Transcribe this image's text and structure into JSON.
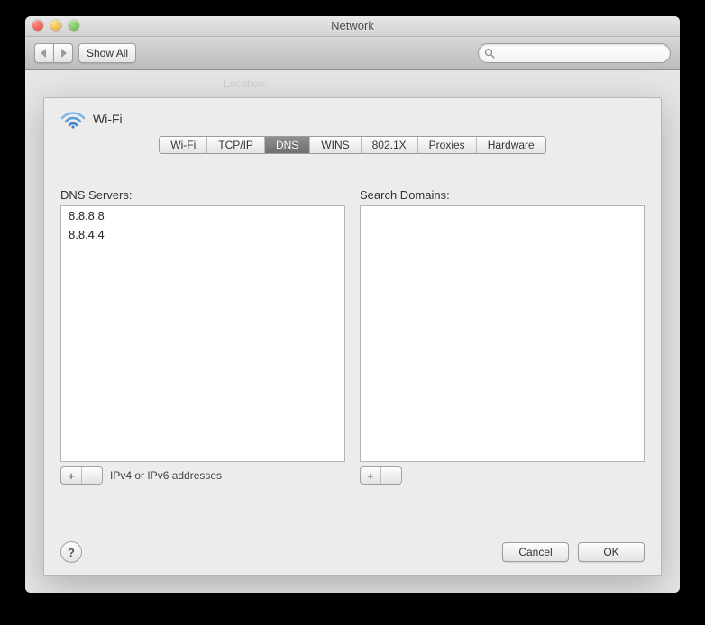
{
  "window": {
    "title": "Network"
  },
  "toolbar": {
    "back_label": "◀",
    "fwd_label": "▶",
    "show_all_label": "Show All",
    "search_placeholder": ""
  },
  "sheet": {
    "interface_name": "Wi-Fi",
    "tabs": [
      {
        "label": "Wi-Fi"
      },
      {
        "label": "TCP/IP"
      },
      {
        "label": "DNS",
        "active": true
      },
      {
        "label": "WINS"
      },
      {
        "label": "802.1X"
      },
      {
        "label": "Proxies"
      },
      {
        "label": "Hardware"
      }
    ],
    "dns": {
      "servers_label": "DNS Servers:",
      "search_domains_label": "Search Domains:",
      "hint": "IPv4 or IPv6 addresses",
      "server_entries": [
        "8.8.8.8",
        "8.8.4.4"
      ],
      "search_domain_entries": [],
      "add_label": "+",
      "remove_label": "−"
    },
    "footer": {
      "help_label": "?",
      "cancel_label": "Cancel",
      "ok_label": "OK"
    }
  },
  "icons": {
    "search": "magnifier-icon",
    "wifi": "wifi-icon"
  }
}
